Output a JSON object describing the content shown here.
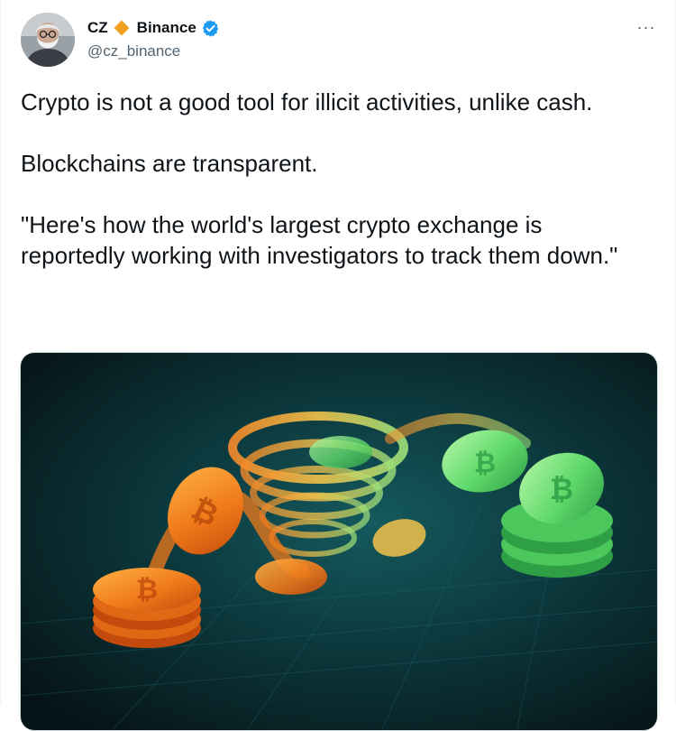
{
  "author": {
    "name": "CZ",
    "name_suffix": "Binance",
    "handle": "@cz_binance",
    "verified": true,
    "badge_icon": "diamond-icon",
    "badge_color": "#F0A21E",
    "verified_color": "#1D9BF0"
  },
  "more_menu": {
    "label": "···",
    "icon": "more-icon"
  },
  "tweet": {
    "paragraphs": [
      "Crypto is not a good tool for illicit activities, unlike cash.",
      "Blockchains are transparent.",
      "\"Here's how the world's largest crypto exchange is reportedly working with investigators to track them down.\""
    ]
  },
  "media": {
    "background_color": "#08262B",
    "coin_colors": {
      "orange": "#F07A1A",
      "green": "#5FD96A"
    }
  }
}
